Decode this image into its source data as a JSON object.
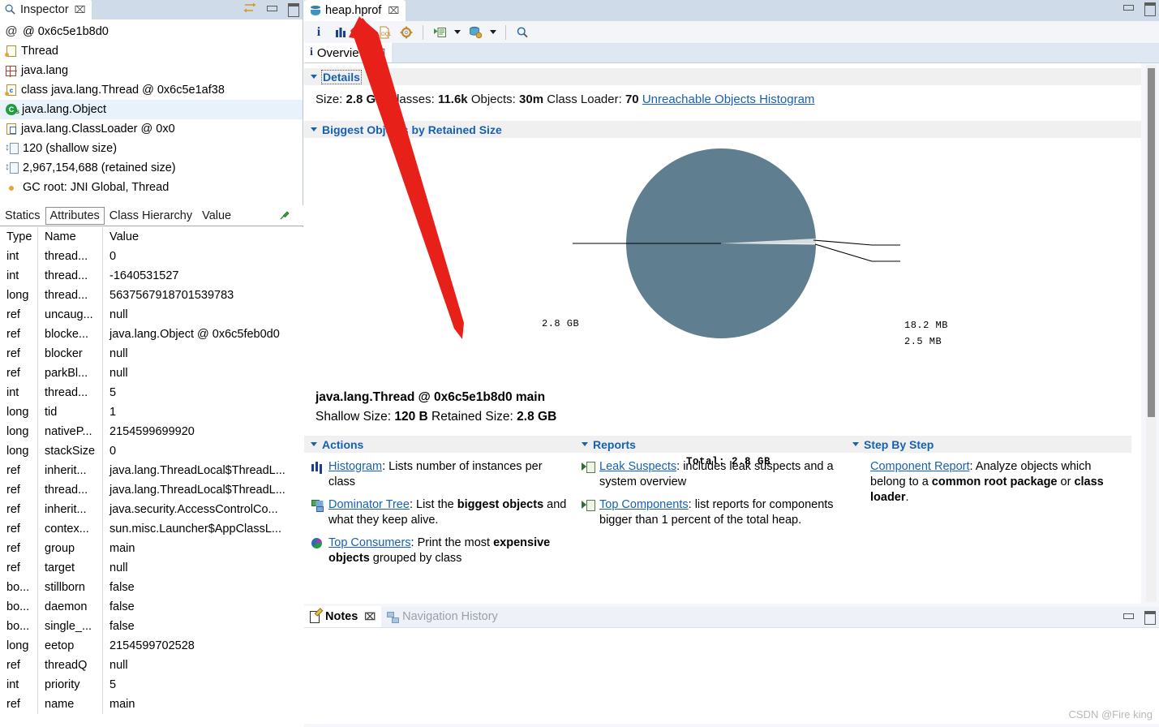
{
  "inspector": {
    "tab_label": "Inspector",
    "tab_close": "⌧",
    "items": [
      {
        "icon": "at-icon",
        "label": "@ 0x6c5e1b8d0"
      },
      {
        "icon": "thread-icon",
        "label": "Thread"
      },
      {
        "icon": "package-icon",
        "label": "java.lang"
      },
      {
        "icon": "class-icon",
        "label": "class java.lang.Thread @ 0x6c5e1af38"
      },
      {
        "icon": "object-icon",
        "label": "java.lang.Object"
      },
      {
        "icon": "classloader-icon",
        "label": "java.lang.ClassLoader @ 0x0"
      },
      {
        "icon": "size-icon",
        "label": "120 (shallow size)"
      },
      {
        "icon": "size-icon",
        "label": "2,967,154,688 (retained size)"
      },
      {
        "icon": "gcroot-icon",
        "label": "GC root: JNI Global, Thread"
      }
    ],
    "selected_index": 4,
    "subtabs": [
      "Statics",
      "Attributes",
      "Class Hierarchy",
      "Value"
    ],
    "active_subtab": "Attributes",
    "table": {
      "columns": [
        "Type",
        "Name",
        "Value"
      ],
      "rows": [
        [
          "int",
          "thread...",
          "0"
        ],
        [
          "int",
          "thread...",
          "-1640531527"
        ],
        [
          "long",
          "thread...",
          "5637567918701539783"
        ],
        [
          "ref",
          "uncaug...",
          "null"
        ],
        [
          "ref",
          "blocke...",
          "java.lang.Object @ 0x6c5feb0d0"
        ],
        [
          "ref",
          "blocker",
          "null"
        ],
        [
          "ref",
          "parkBl...",
          "null"
        ],
        [
          "int",
          "thread...",
          "5"
        ],
        [
          "long",
          "tid",
          "1"
        ],
        [
          "long",
          "nativeP...",
          "2154599699920"
        ],
        [
          "long",
          "stackSize",
          "0"
        ],
        [
          "ref",
          "inherit...",
          "java.lang.ThreadLocal$ThreadL..."
        ],
        [
          "ref",
          "thread...",
          "java.lang.ThreadLocal$ThreadL..."
        ],
        [
          "ref",
          "inherit...",
          "java.security.AccessControlCo..."
        ],
        [
          "ref",
          "contex...",
          "sun.misc.Launcher$AppClassL..."
        ],
        [
          "ref",
          "group",
          "main"
        ],
        [
          "ref",
          "target",
          "null"
        ],
        [
          "bo...",
          "stillborn",
          "false"
        ],
        [
          "bo...",
          "daemon",
          "false"
        ],
        [
          "bo...",
          "single_...",
          "false"
        ],
        [
          "long",
          "eetop",
          "2154599702528"
        ],
        [
          "ref",
          "threadQ",
          "null"
        ],
        [
          "int",
          "priority",
          "5"
        ],
        [
          "ref",
          "name",
          "main"
        ]
      ]
    }
  },
  "editor": {
    "tab_label": "heap.hprof",
    "tab_close": "⌧",
    "toolbar_icons": [
      "overview-info-icon",
      "histogram-icon",
      "dominator-tree-icon",
      "oql-icon",
      "calculate-retained-size-icon",
      "open-report-icon",
      "open-report-dropdown",
      "query-browser-icon",
      "query-browser-dropdown",
      "find-icon"
    ],
    "overview_tab": "Overview",
    "overview_tab_close": "⌧"
  },
  "overview": {
    "details": {
      "title": "Details",
      "size_label": "Size:",
      "size_value": "2.8 GB",
      "classes_label": "Classes:",
      "classes_value": "11.6k",
      "objects_label": "Objects:",
      "objects_value": "30m",
      "loader_label": "Class Loader:",
      "loader_value": "70",
      "link": "Unreachable Objects Histogram"
    },
    "biggest": {
      "title": "Biggest Objects by Retained Size"
    },
    "selected_object": {
      "title": "java.lang.Thread @ 0x6c5e1b8d0 main",
      "shallow_label": "Shallow Size:",
      "shallow_value": "120 B",
      "retained_label": "Retained Size:",
      "retained_value": "2.8 GB"
    },
    "actions": {
      "title": "Actions",
      "items": [
        {
          "icon": "histogram-icon",
          "link": "Histogram",
          "sep": ": ",
          "text_pre": "Lists number of instances per class",
          "bold1": "",
          "text_mid": "",
          "bold2": "",
          "text_post": ""
        },
        {
          "icon": "dominator-tree-icon",
          "link": "Dominator Tree",
          "sep": ": ",
          "text_pre": "List the ",
          "bold1": "biggest objects",
          "text_mid": " and what they keep alive.",
          "bold2": "",
          "text_post": ""
        },
        {
          "icon": "top-consumers-icon",
          "link": "Top Consumers",
          "sep": ": ",
          "text_pre": "Print the most ",
          "bold1": "expensive objects",
          "text_mid": " grouped by class",
          "bold2": "",
          "text_post": ""
        }
      ]
    },
    "reports": {
      "title": "Reports",
      "items": [
        {
          "icon": "report-icon",
          "link": "Leak Suspects",
          "sep": ": ",
          "text_pre": "includes leak suspects and a system overview",
          "bold1": "",
          "text_mid": "",
          "bold2": "",
          "text_post": ""
        },
        {
          "icon": "report-icon",
          "link": "Top Components",
          "sep": ": ",
          "text_pre": "list reports for components bigger than 1 percent of the total heap.",
          "bold1": "",
          "text_mid": "",
          "bold2": "",
          "text_post": ""
        }
      ]
    },
    "stepbystep": {
      "title": "Step By Step",
      "items": [
        {
          "icon": "none",
          "link": "Component Report",
          "sep": ": ",
          "text_pre": "Analyze objects which belong to a ",
          "bold1": "common root package",
          "text_mid": " or ",
          "bold2": "class loader",
          "text_post": "."
        }
      ]
    }
  },
  "chart_data": {
    "type": "pie",
    "title": "Biggest Objects by Retained Size",
    "total_label": "Total: 2.8 GB",
    "labels": [
      "2.8 GB",
      "18.2 MB",
      "2.5 MB"
    ],
    "values": [
      2867.2,
      18.2,
      2.5
    ],
    "unit": "MB",
    "colors": [
      "#5f7e90",
      "#d8dde0",
      "#eef0f1"
    ],
    "legend": "none",
    "callouts": [
      {
        "label": "2.8 GB",
        "side": "left"
      },
      {
        "label": "18.2 MB",
        "side": "right"
      },
      {
        "label": "2.5 MB",
        "side": "right"
      }
    ]
  },
  "notes_panel": {
    "tabs": [
      {
        "label": "Notes",
        "icon": "notes-icon",
        "active": true,
        "close": "⌧"
      },
      {
        "label": "Navigation History",
        "icon": "navigation-history-icon",
        "active": false,
        "close": ""
      }
    ]
  },
  "window_controls": {
    "inspector_link": "link-with-editor-icon",
    "minimize": "minimize-icon",
    "maximize": "maximize-icon"
  },
  "watermark": "CSDN @Fire king",
  "colors": {
    "accent_blue": "#1661b4",
    "pie_main": "#5f7e90",
    "selection": "#e8f2fb",
    "tabbar": "#cfdbe9"
  }
}
